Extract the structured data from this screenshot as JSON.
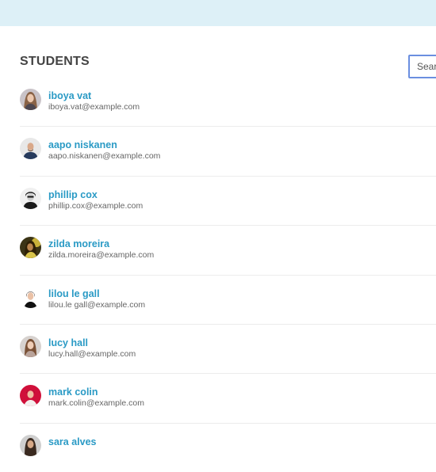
{
  "header": {
    "title": "STUDENTS",
    "search_placeholder": "Search",
    "colors": {
      "top_bar": "#ddf0f7",
      "name": "#2a9ac5",
      "search_border": "#6b8fe0"
    }
  },
  "students": [
    {
      "name": "iboya vat",
      "email": "iboya.vat@example.com",
      "avatar_icon": "woman-portrait-avatar"
    },
    {
      "name": "aapo niskanen",
      "email": "aapo.niskanen@example.com",
      "avatar_icon": "man-portrait-avatar"
    },
    {
      "name": "phillip cox",
      "email": "phillip.cox@example.com",
      "avatar_icon": "man-portrait-avatar"
    },
    {
      "name": "zilda moreira",
      "email": "zilda.moreira@example.com",
      "avatar_icon": "woman-portrait-avatar"
    },
    {
      "name": "lilou le gall",
      "email": "lilou.le gall@example.com",
      "avatar_icon": "woman-portrait-avatar"
    },
    {
      "name": "lucy hall",
      "email": "lucy.hall@example.com",
      "avatar_icon": "woman-portrait-avatar"
    },
    {
      "name": "mark colin",
      "email": "mark.colin@example.com",
      "avatar_icon": "man-portrait-avatar"
    },
    {
      "name": "sara alves",
      "email": "",
      "avatar_icon": "woman-portrait-avatar"
    }
  ]
}
